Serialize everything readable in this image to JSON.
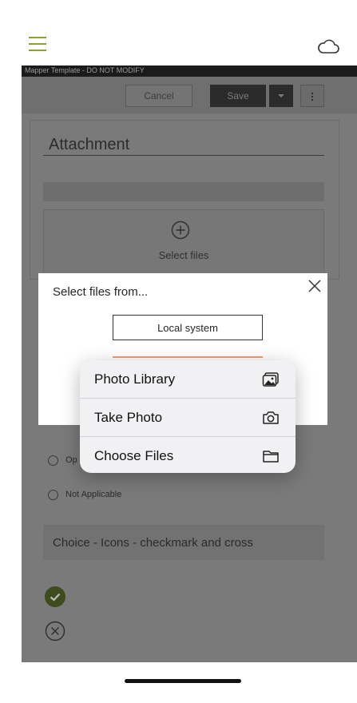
{
  "topbar": {
    "menu_icon": "hamburger-icon",
    "cloud_icon": "cloud-icon",
    "accent_color": "#8aa12f"
  },
  "app": {
    "window_title": "Mapper Template - DO NOT MODIFY",
    "toolbar": {
      "cancel_label": "Cancel",
      "save_label": "Save"
    },
    "attachment_title": "Attachment",
    "upload_label": "Select files",
    "radio_options": [
      "Op",
      "Not Applicable"
    ],
    "choice_label": "Choice - Icons - checkmark and cross"
  },
  "modal": {
    "title": "Select files from...",
    "local_system_label": "Local system"
  },
  "action_menu": {
    "items": [
      {
        "label": "Photo Library",
        "icon": "photo-library-icon"
      },
      {
        "label": "Take Photo",
        "icon": "camera-icon"
      },
      {
        "label": "Choose Files",
        "icon": "folder-icon"
      }
    ]
  }
}
